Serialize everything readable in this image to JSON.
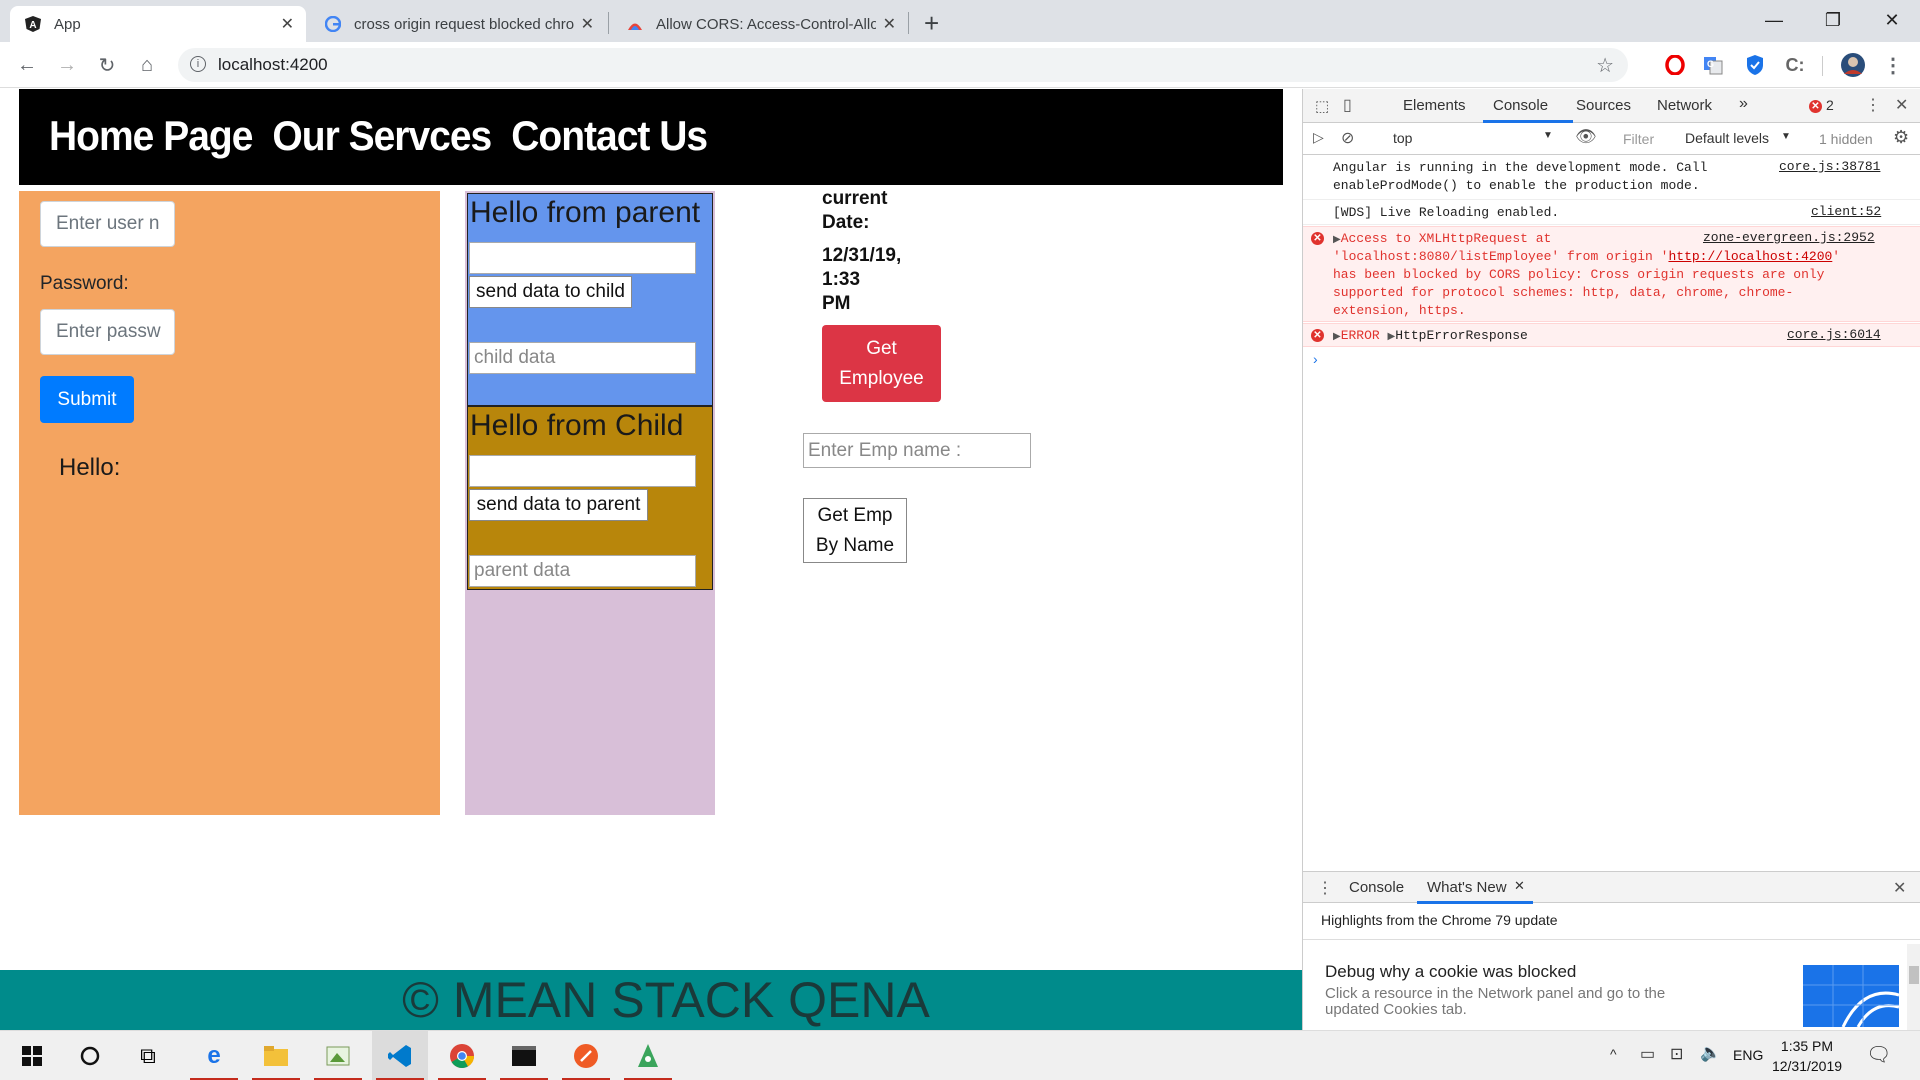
{
  "browser": {
    "tabs": [
      {
        "title": "App",
        "icon": "angular-icon"
      },
      {
        "title": "cross origin request blocked chro",
        "icon": "google-icon"
      },
      {
        "title": "Allow CORS: Access-Control-Allo",
        "icon": "chrome-webstore-icon"
      }
    ],
    "url": "localhost:4200"
  },
  "nav": {
    "links": [
      "Home Page",
      "Our Servces",
      "Contact Us"
    ]
  },
  "login": {
    "username_placeholder": "Enter user n",
    "password_label": "Password:",
    "password_placeholder": "Enter passw",
    "submit_label": "Submit",
    "hello_label": "Hello:"
  },
  "parent": {
    "heading": "Hello from parent",
    "send_label": "send data to child",
    "child_data_placeholder": "child data"
  },
  "child": {
    "heading": "Hello from Child",
    "send_label": "send data to parent",
    "parent_data_placeholder": "parent data"
  },
  "date": {
    "label_line1": "current",
    "label_line2": "Date:",
    "value_line1": "12/31/19,",
    "value_line2": "1:33",
    "value_line3": "PM"
  },
  "employee": {
    "get_line1": "Get",
    "get_line2": "Employee",
    "name_placeholder": "Enter Emp name :",
    "byname_line1": "Get Emp",
    "byname_line2": "By Name"
  },
  "footer": {
    "text": "© MEAN STACK QENA"
  },
  "devtools": {
    "tabs": [
      "Elements",
      "Console",
      "Sources",
      "Network"
    ],
    "error_count": "2",
    "context": "top",
    "filter_placeholder": "Filter",
    "levels": "Default levels",
    "hidden": "1 hidden",
    "logs": [
      {
        "text1": "Angular is running in the development mode. Call",
        "text2": "enableProdMode() to enable the production mode.",
        "source": "core.js:38781"
      },
      {
        "text1": "[WDS] Live Reloading enabled.",
        "source": "client:52"
      }
    ],
    "error1": {
      "line1": "Access to XMLHttpRequest at",
      "source": "zone-evergreen.js:2952",
      "line2a": "'localhost:8080/listEmployee' from origin '",
      "line2link": "http://localhost:4200",
      "line2b": "'",
      "line3": "has been blocked by CORS policy: Cross origin requests are only",
      "line4": "supported for protocol schemes: http, data, chrome, chrome-",
      "line5": "extension, https."
    },
    "error2": {
      "label": "ERROR",
      "obj": "HttpErrorResponse",
      "source": "core.js:6014"
    },
    "drawer": {
      "tabs": [
        "Console",
        "What's New"
      ],
      "highlights": "Highlights from the Chrome 79 update",
      "item_title": "Debug why a cookie was blocked",
      "item_desc1": "Click a resource in the Network panel and go to the",
      "item_desc2": "updated Cookies tab."
    }
  },
  "taskbar": {
    "lang": "ENG",
    "time": "1:35 PM",
    "date": "12/31/2019"
  }
}
